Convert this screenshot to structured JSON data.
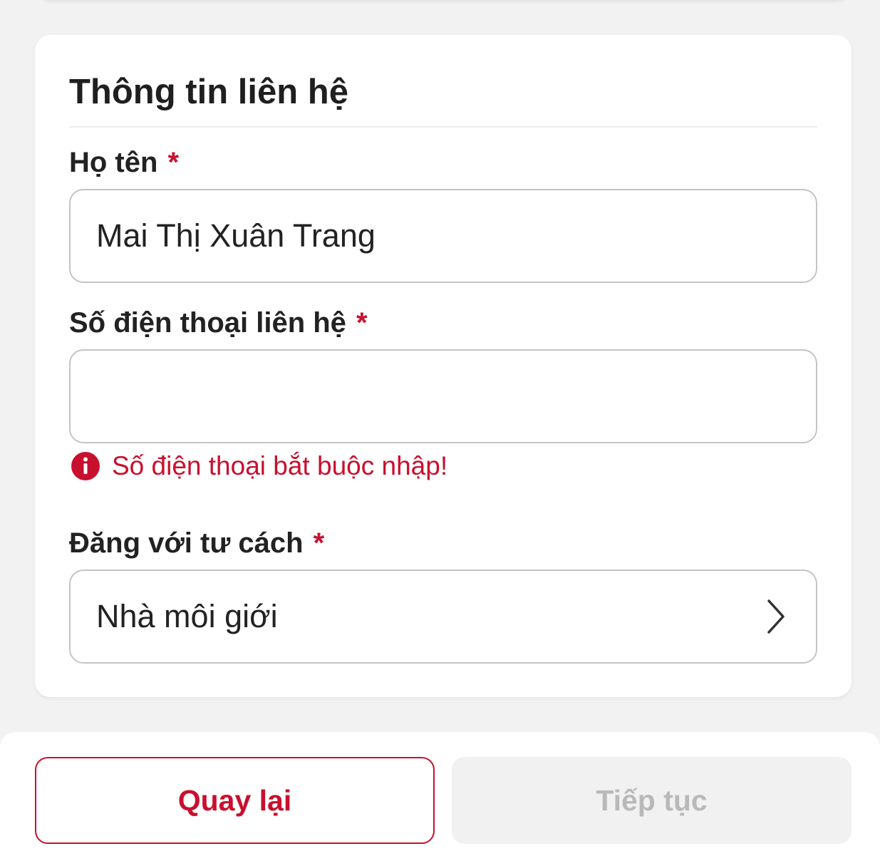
{
  "section": {
    "title": "Thông tin liên hệ"
  },
  "fields": {
    "full_name": {
      "label": "Họ tên",
      "required_mark": "*",
      "value": "Mai Thị Xuân Trang"
    },
    "phone": {
      "label": "Số điện thoại liên hệ",
      "required_mark": "*",
      "value": "",
      "error": "Số điện thoại bắt buộc nhập!"
    },
    "post_as": {
      "label": "Đăng với tư cách",
      "required_mark": "*",
      "value": "Nhà môi giới"
    }
  },
  "footer": {
    "back_label": "Quay lại",
    "next_label": "Tiếp tục"
  },
  "colors": {
    "accent": "#c8102e",
    "disabled_text": "#b9b9b9",
    "disabled_bg": "#f1f1f1",
    "border": "#c4c4c4"
  },
  "icons": {
    "error": "error-info-icon",
    "select": "chevron-right-icon"
  }
}
